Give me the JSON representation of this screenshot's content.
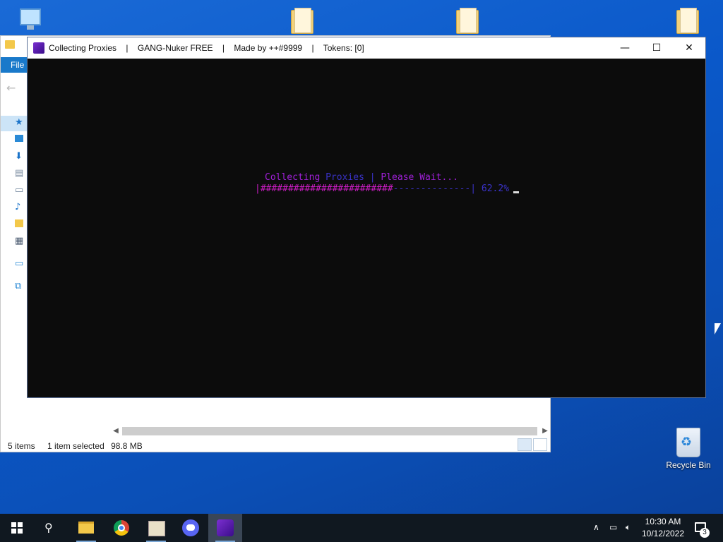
{
  "desktop": {
    "recycle_bin_label": "Recycle Bin"
  },
  "explorer": {
    "ribbon_file_label": "File",
    "status": {
      "items": "5 items",
      "selection": "1 item selected",
      "size": "98.8 MB"
    }
  },
  "console_window": {
    "title_segments": [
      "Collecting Proxies",
      "GANG-Nuker FREE",
      "Made by ++#9999",
      "Tokens: [0]"
    ],
    "title_separator": "|",
    "minimize_glyph": "—",
    "maximize_glyph": "☐",
    "close_glyph": "✕",
    "line1": {
      "prefix": "Collecting",
      "highlight": "Proxies",
      "separator": "|",
      "suffix": "Please Wait..."
    },
    "progress": {
      "left_bracket": "|",
      "filled": "########################",
      "empty": "--------------",
      "right_bracket": "|",
      "percent_text": "62.2%",
      "value": 62.2
    },
    "colors": {
      "purple": "#a020d8",
      "blue": "#3a32c8",
      "magenta": "#c81cc0"
    }
  },
  "taskbar": {
    "time": "10:30 AM",
    "date": "10/12/2022",
    "notification_count": "3"
  }
}
